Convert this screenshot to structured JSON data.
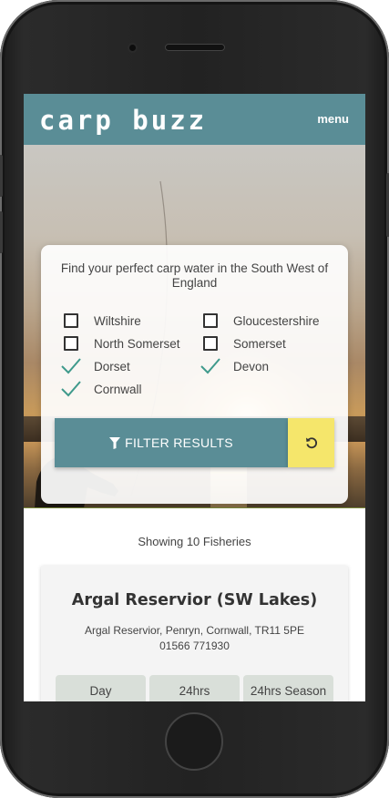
{
  "header": {
    "logo_text": "carp buzz",
    "menu_label": "menu"
  },
  "filter": {
    "heading": "Find your perfect carp water in the South West of England",
    "options": [
      {
        "label": "Wiltshire",
        "checked": false
      },
      {
        "label": "Gloucestershire",
        "checked": false
      },
      {
        "label": "North Somerset",
        "checked": false
      },
      {
        "label": "Somerset",
        "checked": false
      },
      {
        "label": "Dorset",
        "checked": true
      },
      {
        "label": "Devon",
        "checked": true
      },
      {
        "label": "Cornwall",
        "checked": true
      }
    ],
    "filter_button_label": "FILTER RESULTS",
    "filter_icon": "filter-icon",
    "reset_icon": "reset-icon"
  },
  "results": {
    "count_text": "Showing 10 Fisheries"
  },
  "fisheries": [
    {
      "name": "Argal Reservior (SW Lakes)",
      "address": "Argal Reservior, Penryn, Cornwall, TR11 5PE",
      "phone": "01566 771930",
      "ticket_tabs": [
        "Day",
        "24hrs",
        "24hrs Season"
      ]
    }
  ],
  "colors": {
    "brand": "#5a8d96",
    "reset_button": "#f5e66b",
    "check": "#3f9a8c"
  }
}
